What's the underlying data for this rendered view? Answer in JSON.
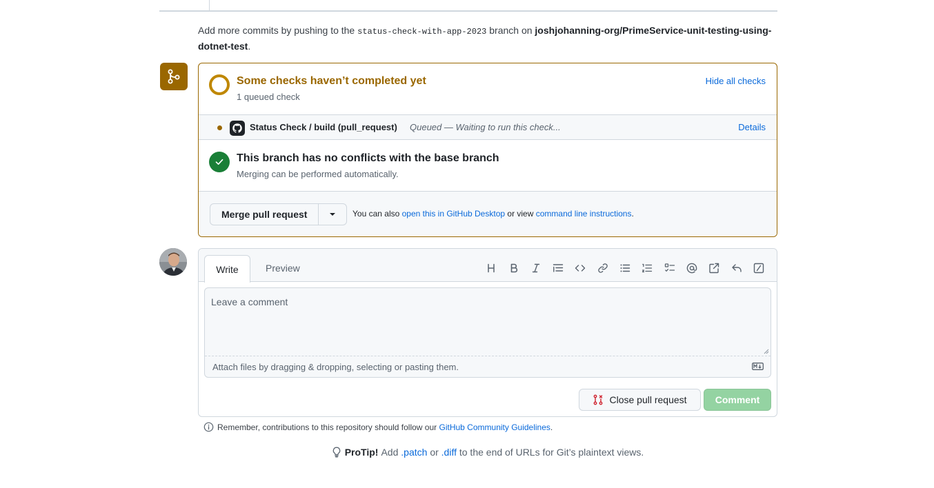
{
  "commit_note": {
    "prefix": "Add more commits by pushing to the",
    "branch": "status-check-with-app-2023",
    "middle": "branch on",
    "repo": "joshjohanning-org/PrimeService-unit-testing-using-dotnet-test",
    "suffix": "."
  },
  "checks": {
    "title": "Some checks haven’t completed yet",
    "subtitle": "1 queued check",
    "hide_link": "Hide all checks",
    "items": [
      {
        "name": "Status Check / build (pull_request)",
        "status": "Queued — Waiting to run this check...",
        "details_link": "Details"
      }
    ]
  },
  "conflicts": {
    "title": "This branch has no conflicts with the base branch",
    "subtitle": "Merging can be performed automatically."
  },
  "merge": {
    "button_label": "Merge pull request",
    "also_text": "You can also",
    "desktop_link": "open this in GitHub Desktop",
    "or_view": "or view",
    "cli_link": "command line instructions",
    "period": "."
  },
  "comment": {
    "tabs": {
      "write": "Write",
      "preview": "Preview"
    },
    "toolbar": [
      "heading-icon",
      "bold-icon",
      "italic-icon",
      "quote-icon",
      "code-icon",
      "link-icon",
      "unordered-list-icon",
      "ordered-list-icon",
      "task-list-icon",
      "mention-icon",
      "cross-reference-icon",
      "reply-icon",
      "slash-command-icon"
    ],
    "placeholder": "Leave a comment",
    "attach_text": "Attach files by dragging & dropping, selecting or pasting them.",
    "close_label": "Close pull request",
    "comment_label": "Comment"
  },
  "remember": {
    "text": "Remember, contributions to this repository should follow our",
    "link": "GitHub Community Guidelines",
    "period": "."
  },
  "protip": {
    "label": "ProTip!",
    "t1": "Add",
    "patch": ".patch",
    "t2": "or",
    "diff": ".diff",
    "t3": "to the end of URLs for Git’s plaintext views."
  },
  "colors": {
    "pending": "#9a6700",
    "success": "#1a7f37",
    "link": "#0969da",
    "comment_button": "#94d3a2",
    "close_icon": "#cf222e"
  }
}
